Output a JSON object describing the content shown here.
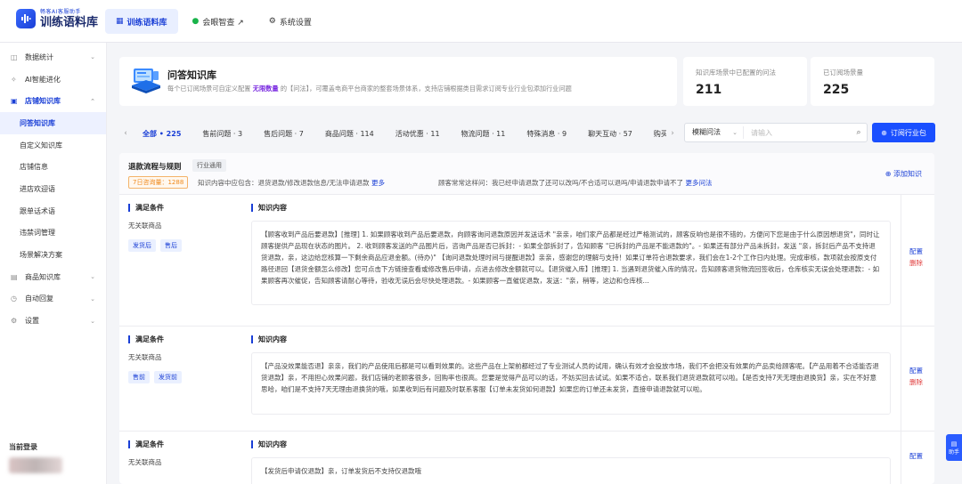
{
  "app": {
    "logo_sub": "畅客AI客服助手",
    "logo_main": "训练语料库"
  },
  "top_nav": [
    {
      "label": "训练语料库",
      "active": true
    },
    {
      "label": "会眼智查 ↗",
      "active": false
    },
    {
      "label": "系统设置",
      "active": false
    }
  ],
  "sidebar": {
    "items": [
      {
        "label": "数据统计",
        "icon": "chart-icon",
        "chevron": "⌄"
      },
      {
        "label": "AI智能进化",
        "icon": "magic-icon",
        "chevron": ""
      },
      {
        "label": "店铺知识库",
        "icon": "book-icon",
        "chevron": "⌃",
        "open": true
      }
    ],
    "subitems": [
      {
        "label": "问答知识库",
        "active": true
      },
      {
        "label": "自定义知识库",
        "active": false
      },
      {
        "label": "店铺信息",
        "active": false
      },
      {
        "label": "进店欢迎语",
        "active": false
      },
      {
        "label": "跟单话术语",
        "active": false
      },
      {
        "label": "违禁词管理",
        "active": false
      },
      {
        "label": "场景解决方案",
        "active": false
      }
    ],
    "items_after": [
      {
        "label": "商品知识库",
        "icon": "box-icon",
        "chevron": "⌄"
      },
      {
        "label": "自动回复",
        "icon": "reply-icon",
        "chevron": "⌄"
      },
      {
        "label": "设置",
        "icon": "gear-icon",
        "chevron": "⌄"
      }
    ],
    "current_login": "当前登录"
  },
  "header": {
    "title": "问答知识库",
    "desc_prefix": "每个已订阅场景可自定义配置",
    "desc_highlight": "无限数量",
    "desc_suffix": "的【问法】，可覆盖电商平台商家的整套场景体系，支持店铺根据类目需求订阅专业行业包添加行业问题"
  },
  "stats": [
    {
      "label": "知识库场景中已配置的问法",
      "value": "211"
    },
    {
      "label": "已订阅场景量",
      "value": "225"
    }
  ],
  "tabs": [
    {
      "label": "全部 • 225",
      "active": true
    },
    {
      "label": "售前问题 · 3"
    },
    {
      "label": "售后问题 · 7"
    },
    {
      "label": "商品问题 · 114"
    },
    {
      "label": "活动优惠 · 11"
    },
    {
      "label": "物流问题 · 11"
    },
    {
      "label": "特殊消息 · 9"
    },
    {
      "label": "聊天互动 · 57"
    },
    {
      "label": "购买操"
    }
  ],
  "search": {
    "mode": "模糊问法",
    "placeholder": "请输入"
  },
  "subscribe_label": "订阅行业包",
  "panel": {
    "title": "退款流程与规则",
    "tag": "行业通用",
    "week": "7日咨询量：1288",
    "info1_label": "知识内容中应包含：退货退款/修改退款信息/无法申请退款",
    "info1_more": "更多",
    "info2_label": "顾客常常这样问：我已经申请退款了还可以改吗/不合适可以退吗/申请退款申请不了",
    "info2_more": "更多问法",
    "add_label": "添加知识"
  },
  "rows": [
    {
      "cond_title": "满足条件",
      "cond_text": "无关联商品",
      "badges": [
        "发货后",
        "售后"
      ],
      "ki_title": "知识内容",
      "content": "【顾客收到产品后要退款】[推理] 1. 如果顾客收到产品后要退款，向顾客询问退款原因并发送话术 \"亲亲，咱们家产品都是经过严格测试的，顾客反响也是很不错的，方便问下您是由于什么原因想退货\"，同时让顾客提供产品现在状态的图片。 2. 收到顾客发送的产品图片后，咨询产品是否已拆封：- 如果全部拆封了，告知顾客 \"已拆封的产品是不能退款的\"。- 如果还有部分产品未拆封，发送 \"亲，拆封后产品不支持退货退款，亲，这边给您核算一下剩余商品应退金额。(待办)\" 【询问退款处理时间与提醒退款】亲亲，感谢您的理解与支持！如果订单符合退款要求，我们会在1-2个工作日内处理。完成审核，款项就会按原支付路径退回【退货金额怎么修改】您可点击下方链接查看或修改售后申请，点进去修改金额就可以。【退货催入库】[推理] 1. 当遇到退货催入库的情况，告知顾客退货物流回签收后，仓库核实无误会处理退款：- 如果顾客再次催促，告知顾客请耐心等待，验收无误后会尽快处理退款。- 如果顾客一直催促退款，发送：\"亲，稍等，这边和仓库核...",
      "edit": "配置",
      "del": "删除"
    },
    {
      "cond_title": "满足条件",
      "cond_text": "无关联商品",
      "badges": [
        "售前",
        "发货前"
      ],
      "ki_title": "知识内容",
      "content": "【产品没效果能否退】亲亲，我们的产品使用后都是可以看到效果的。这些产品在上架前都经过了专业测试人员的试用，确认有效才会投放市场，我们不会把没有效果的产品卖给顾客呢。【产品用着不合适能否退货退款】亲，不用担心效果问题，我们店铺的老顾客很多，回购率也很高。您要是觉得产品可以的话，不妨买回去试试。如果不适合，联系我们退货退款就可以啦。【是否支持7天无理由退换货】亲，实在不好意思哈，咱们是不支持7天无理由退换货的哦，如果收到后有问题及时联系客服【订单未发货如何退款】如果您的订单还未发货，直接申请退款就可以啦。",
      "edit": "配置",
      "del": "删除"
    },
    {
      "cond_title": "满足条件",
      "cond_text": "无关联商品",
      "badges": [],
      "ki_title": "知识内容",
      "content": "【发货后申请仅退款】亲，订单发货后不支持仅退款哦",
      "edit": "配置",
      "del": ""
    }
  ],
  "float_btn": "助手"
}
